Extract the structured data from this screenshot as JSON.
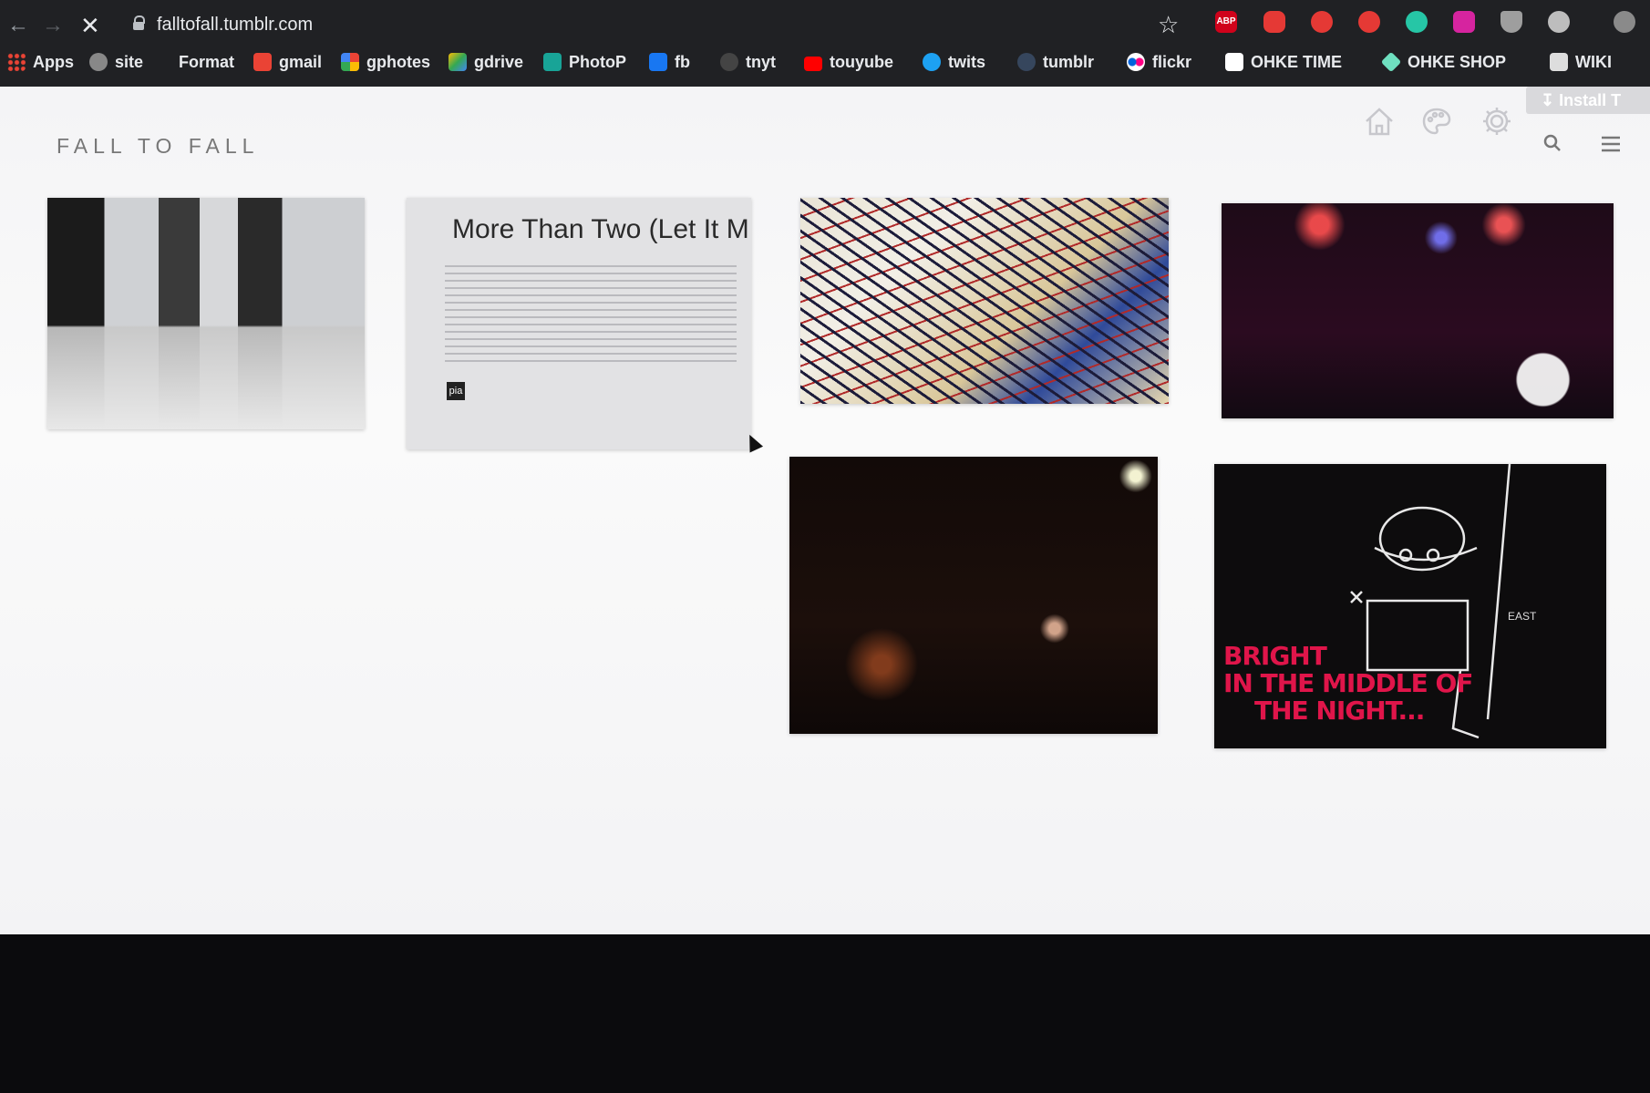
{
  "browser": {
    "url": "falltofall.tumblr.com",
    "bookmarks": [
      {
        "label": "Apps",
        "icon": "apps-grid-icon"
      },
      {
        "label": "site",
        "icon": "site-icon"
      },
      {
        "label": "Format",
        "icon": "format-icon"
      },
      {
        "label": "gmail",
        "icon": "gmail-icon"
      },
      {
        "label": "gphotes",
        "icon": "gphotos-icon"
      },
      {
        "label": "gdrive",
        "icon": "gdrive-icon"
      },
      {
        "label": "PhotoP",
        "icon": "photopea-icon"
      },
      {
        "label": "fb",
        "icon": "facebook-icon"
      },
      {
        "label": "tnyt",
        "icon": "nyt-icon"
      },
      {
        "label": "touyube",
        "icon": "youtube-icon"
      },
      {
        "label": "twits",
        "icon": "twitter-icon"
      },
      {
        "label": "tumblr",
        "icon": "tumblr-icon"
      },
      {
        "label": "flickr",
        "icon": "flickr-icon"
      },
      {
        "label": "OHKE TIME",
        "icon": "ohke-time-icon"
      },
      {
        "label": "OHKE SHOP",
        "icon": "ohke-shop-icon"
      },
      {
        "label": "WIKI",
        "icon": "wikipedia-icon"
      }
    ],
    "extensions": {
      "abp": "ABP"
    },
    "install_label": "Install T"
  },
  "page": {
    "site_title": "FALL TO FALL",
    "posts": [
      {
        "id": "gallery-photo"
      },
      {
        "id": "more-than-two",
        "title": "More Than Two (Let It M",
        "logo": "pia"
      },
      {
        "id": "graffiti-wall"
      },
      {
        "id": "concert-stage"
      },
      {
        "id": "night-street"
      },
      {
        "id": "chalk-drawing",
        "text_line1": "BRIGHT",
        "text_line2": "IN THE MIDDLE OF",
        "text_line3": "THE NIGHT...",
        "signature": "EAST"
      }
    ]
  },
  "colors": {
    "chrome_bg": "#202124",
    "page_bg": "#f7f7f8",
    "title_gray": "#777777",
    "icon_gray": "#c7c7cc",
    "chalk_red": "#e0154a"
  }
}
